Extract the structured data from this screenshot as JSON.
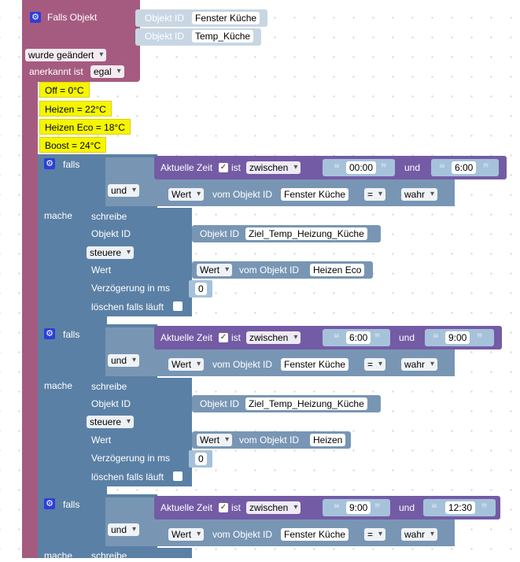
{
  "trigger": {
    "label": "Falls Objekt",
    "obj_label_1": "Objekt ID",
    "obj_value_1": "Fenster Küche",
    "obj_label_2": "Objekt ID",
    "obj_value_2": "Temp_Küche",
    "change_mode": "wurde geändert",
    "ack_label": "anerkannt ist",
    "ack_value": "egal"
  },
  "comments": [
    "Off = 0°C",
    "Heizen = 22°C",
    "Heizen Eco = 18°C",
    "Boost = 24°C"
  ],
  "blocks": [
    {
      "falls": "falls",
      "time_label": "Aktuelle Zeit",
      "ist": "ist",
      "op": "zwischen",
      "from": "00:00",
      "und": "und",
      "to": "6:00",
      "und_dd": "und",
      "wert": "Wert",
      "vom": "vom Objekt ID",
      "obj": "Fenster Küche",
      "eq": "=",
      "bool": "wahr",
      "mache": "mache",
      "schreibe": "schreibe",
      "obj_id_label": "Objekt ID",
      "target_label": "Objekt ID",
      "target": "Ziel_Temp_Heizung_Küche",
      "steuere": "steuere",
      "wert_label": "Wert",
      "wert_dd": "Wert",
      "vom2": "vom Objekt ID",
      "source": "Heizen Eco",
      "delay_label": "Verzögerung in ms",
      "delay": "0",
      "clear_label": "löschen falls läuft"
    },
    {
      "falls": "falls",
      "time_label": "Aktuelle Zeit",
      "ist": "ist",
      "op": "zwischen",
      "from": "6:00",
      "und": "und",
      "to": "9:00",
      "und_dd": "und",
      "wert": "Wert",
      "vom": "vom Objekt ID",
      "obj": "Fenster Küche",
      "eq": "=",
      "bool": "wahr",
      "mache": "mache",
      "schreibe": "schreibe",
      "obj_id_label": "Objekt ID",
      "target_label": "Objekt ID",
      "target": "Ziel_Temp_Heizung_Küche",
      "steuere": "steuere",
      "wert_label": "Wert",
      "wert_dd": "Wert",
      "vom2": "vom Objekt ID",
      "source": "Heizen",
      "delay_label": "Verzögerung in ms",
      "delay": "0",
      "clear_label": "löschen falls läuft"
    },
    {
      "falls": "falls",
      "time_label": "Aktuelle Zeit",
      "ist": "ist",
      "op": "zwischen",
      "from": "9:00",
      "und": "und",
      "to": "12:30",
      "und_dd": "und",
      "wert": "Wert",
      "vom": "vom Objekt ID",
      "obj": "Fenster Küche",
      "eq": "=",
      "bool": "wahr",
      "mache": "mache",
      "schreibe": "schreibe"
    }
  ]
}
